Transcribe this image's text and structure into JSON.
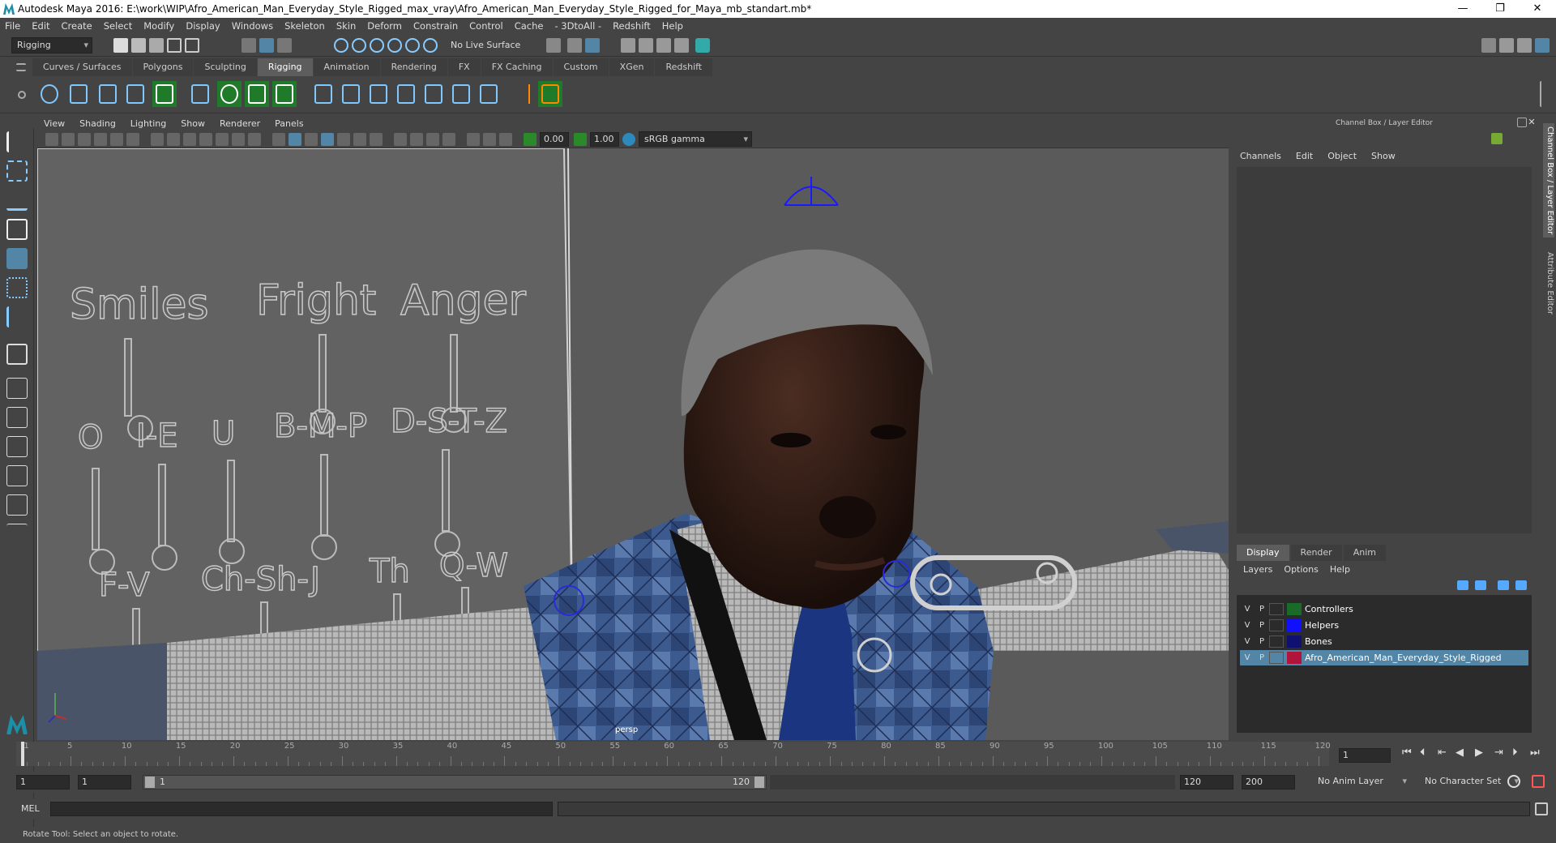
{
  "window": {
    "title": "Autodesk Maya 2016: E:\\work\\WIP\\Afro_American_Man_Everyday_Style_Rigged_max_vray\\Afro_American_Man_Everyday_Style_Rigged_for_Maya_mb_standart.mb*",
    "minimize": "—",
    "restore": "❐",
    "close": "✕"
  },
  "menubar": [
    "File",
    "Edit",
    "Create",
    "Select",
    "Modify",
    "Display",
    "Windows",
    "Skeleton",
    "Skin",
    "Deform",
    "Constrain",
    "Control",
    "Cache",
    "- 3DtoAll -",
    "Redshift",
    "Help"
  ],
  "statusline": {
    "mode": "Rigging",
    "live_surface": "No Live Surface"
  },
  "shelf": {
    "tabs": [
      "Curves / Surfaces",
      "Polygons",
      "Sculpting",
      "Rigging",
      "Animation",
      "Rendering",
      "FX",
      "FX Caching",
      "Custom",
      "XGen",
      "Redshift"
    ],
    "active": "Rigging"
  },
  "viewport": {
    "menu": [
      "View",
      "Shading",
      "Lighting",
      "Show",
      "Renderer",
      "Panels"
    ],
    "exposure": "0.00",
    "gamma": "1.00",
    "colorspace": "sRGB gamma",
    "camera": "persp"
  },
  "face_ui": {
    "labels": [
      "Smiles",
      "Fright",
      "Anger",
      "O",
      "I-E",
      "U",
      "B-M-P",
      "D-S-T-Z",
      "F-V",
      "Ch-Sh-J",
      "Th",
      "Q-W"
    ]
  },
  "channelbox": {
    "header": "Channel Box / Layer Editor",
    "menu": [
      "Channels",
      "Edit",
      "Object",
      "Show"
    ]
  },
  "layers": {
    "tabs": [
      "Display",
      "Render",
      "Anim"
    ],
    "active": "Display",
    "menu": [
      "Layers",
      "Options",
      "Help"
    ],
    "rows": [
      {
        "v": "V",
        "p": "P",
        "name": "Controllers",
        "color": "#1a6b2a"
      },
      {
        "v": "V",
        "p": "P",
        "name": "Helpers",
        "color": "#1010ff"
      },
      {
        "v": "V",
        "p": "P",
        "name": "Bones",
        "color": "#101070"
      },
      {
        "v": "V",
        "p": "P",
        "name": "Afro_American_Man_Everyday_Style_Rigged",
        "color": "#b0143a"
      }
    ]
  },
  "side_tabs": [
    "Channel Box / Layer Editor",
    "Attribute Editor"
  ],
  "timeline": {
    "labels": [
      "1",
      "5",
      "10",
      "15",
      "20",
      "25",
      "30",
      "35",
      "40",
      "45",
      "50",
      "55",
      "60",
      "65",
      "70",
      "75",
      "80",
      "85",
      "90",
      "95",
      "100",
      "105",
      "110",
      "115",
      "120"
    ],
    "current": "1"
  },
  "range": {
    "start": "1",
    "start2": "1",
    "slider_start": "1",
    "slider_end": "120",
    "end": "120",
    "end2": "200",
    "anim_layer": "No Anim Layer",
    "char_set": "No Character Set"
  },
  "cmd": {
    "label": "MEL"
  },
  "help": "Rotate Tool: Select an object to rotate."
}
